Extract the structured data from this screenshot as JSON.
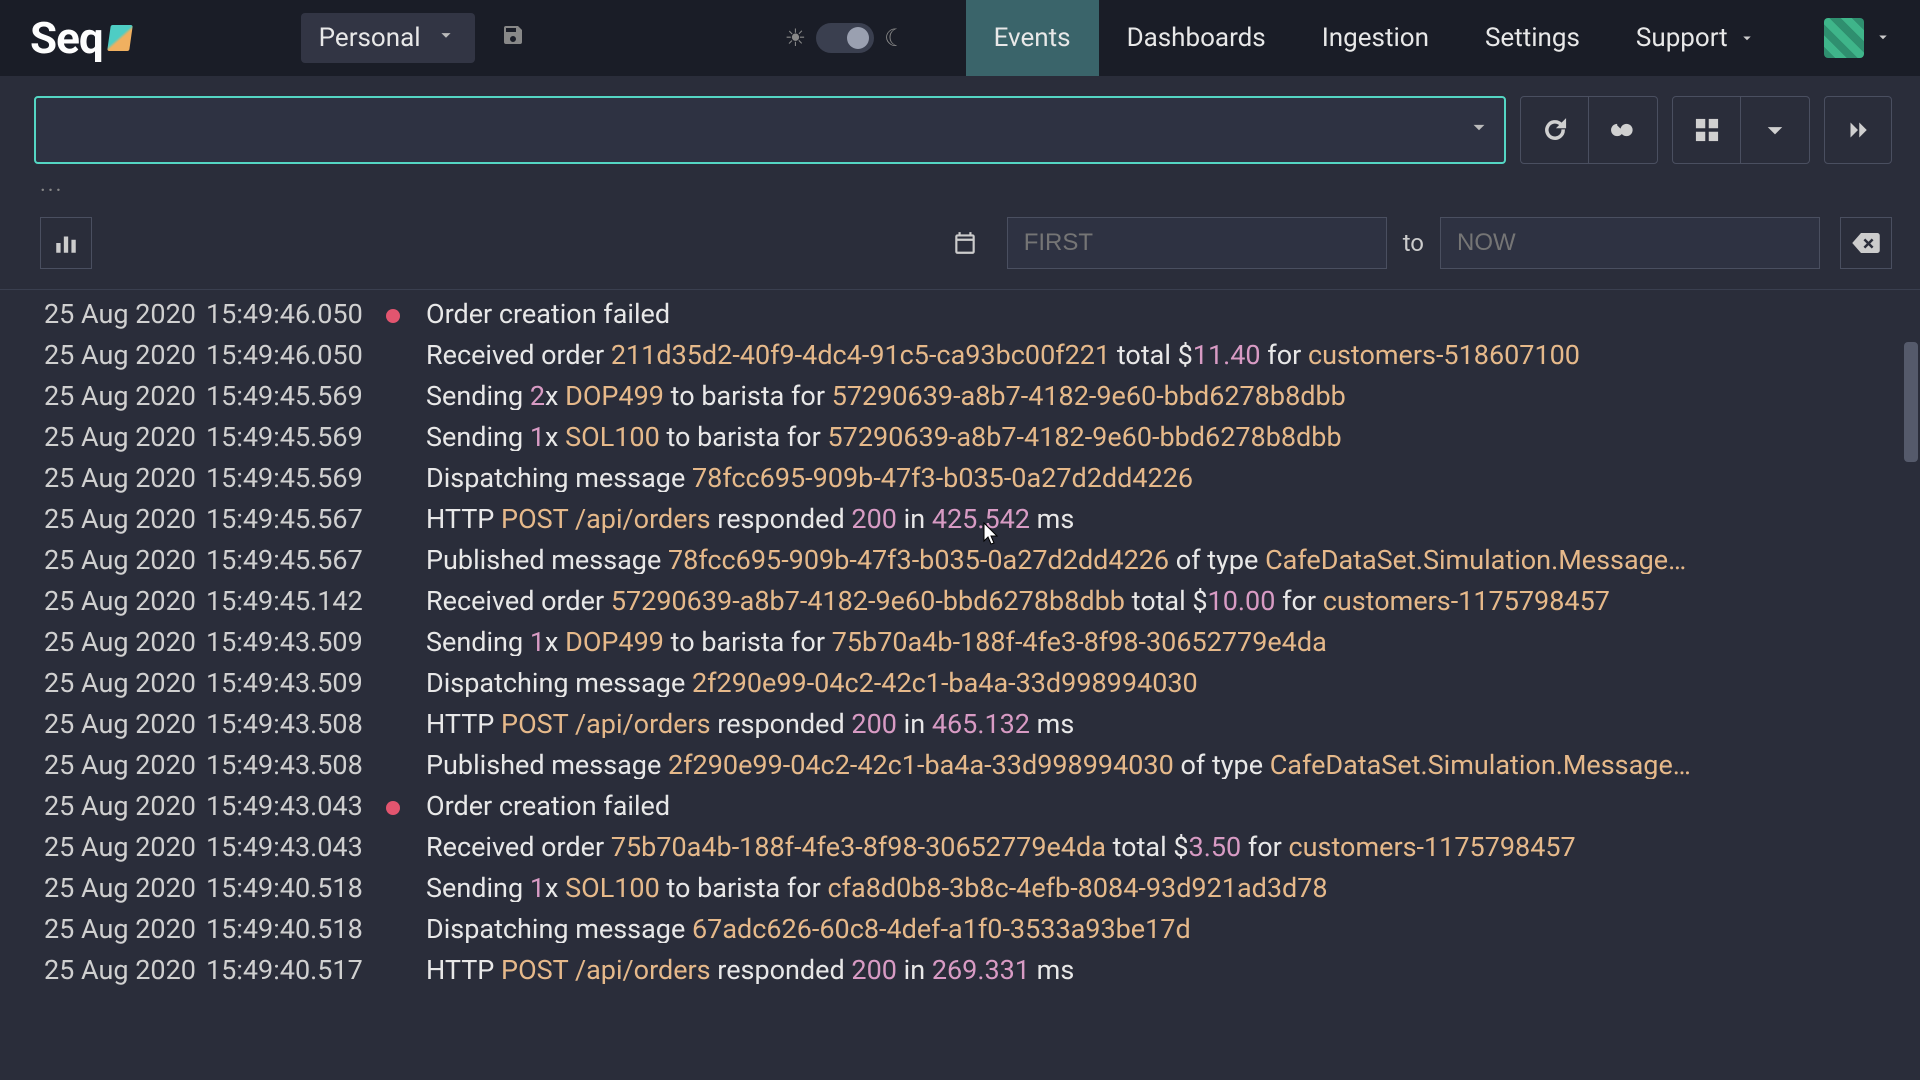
{
  "nav": {
    "logo_text": "Seq",
    "workspace": "Personal",
    "tabs": [
      "Events",
      "Dashboards",
      "Ingestion",
      "Settings",
      "Support"
    ],
    "active_tab": "Events"
  },
  "query": {
    "value": ""
  },
  "signals": {
    "placeholder": "..."
  },
  "range": {
    "from_placeholder": "FIRST",
    "to_label": "to",
    "to_placeholder": "NOW"
  },
  "colors": {
    "error": "#e2556f",
    "accent": "#54d6c3"
  },
  "events": [
    {
      "date": "25 Aug 2020",
      "time": "15:49:46.050",
      "level": "error",
      "parts": [
        {
          "t": "Order creation failed"
        }
      ]
    },
    {
      "date": "25 Aug 2020",
      "time": "15:49:46.050",
      "parts": [
        {
          "t": "Received order "
        },
        {
          "t": "211d35d2-40f9-4dc4-91c5-ca93bc00f221",
          "c": "tok-guid"
        },
        {
          "t": " total $"
        },
        {
          "t": "11.40",
          "c": "tok-num"
        },
        {
          "t": " for "
        },
        {
          "t": "customers-518607100",
          "c": "tok-cust"
        }
      ]
    },
    {
      "date": "25 Aug 2020",
      "time": "15:49:45.569",
      "parts": [
        {
          "t": "Sending "
        },
        {
          "t": "2",
          "c": "tok-num"
        },
        {
          "t": "x "
        },
        {
          "t": "DOP499",
          "c": "tok-code"
        },
        {
          "t": " to barista for "
        },
        {
          "t": "57290639-a8b7-4182-9e60-bbd6278b8dbb",
          "c": "tok-guid"
        }
      ]
    },
    {
      "date": "25 Aug 2020",
      "time": "15:49:45.569",
      "parts": [
        {
          "t": "Sending "
        },
        {
          "t": "1",
          "c": "tok-num"
        },
        {
          "t": "x "
        },
        {
          "t": "SOL100",
          "c": "tok-code"
        },
        {
          "t": " to barista for "
        },
        {
          "t": "57290639-a8b7-4182-9e60-bbd6278b8dbb",
          "c": "tok-guid"
        }
      ]
    },
    {
      "date": "25 Aug 2020",
      "time": "15:49:45.569",
      "parts": [
        {
          "t": "Dispatching message "
        },
        {
          "t": "78fcc695-909b-47f3-b035-0a27d2dd4226",
          "c": "tok-guid"
        }
      ]
    },
    {
      "date": "25 Aug 2020",
      "time": "15:49:45.567",
      "parts": [
        {
          "t": "HTTP "
        },
        {
          "t": "POST",
          "c": "tok-post"
        },
        {
          "t": " "
        },
        {
          "t": "/api/orders",
          "c": "tok-path"
        },
        {
          "t": " responded "
        },
        {
          "t": "200",
          "c": "tok-num"
        },
        {
          "t": " in "
        },
        {
          "t": "425.542",
          "c": "tok-num"
        },
        {
          "t": " ms"
        }
      ]
    },
    {
      "date": "25 Aug 2020",
      "time": "15:49:45.567",
      "parts": [
        {
          "t": "Published message "
        },
        {
          "t": "78fcc695-909b-47f3-b035-0a27d2dd4226",
          "c": "tok-guid"
        },
        {
          "t": " of type "
        },
        {
          "t": "CafeDataSet.Simulation.Message…",
          "c": "tok-type"
        }
      ]
    },
    {
      "date": "25 Aug 2020",
      "time": "15:49:45.142",
      "parts": [
        {
          "t": "Received order "
        },
        {
          "t": "57290639-a8b7-4182-9e60-bbd6278b8dbb",
          "c": "tok-guid"
        },
        {
          "t": " total $"
        },
        {
          "t": "10.00",
          "c": "tok-num"
        },
        {
          "t": " for "
        },
        {
          "t": "customers-1175798457",
          "c": "tok-cust"
        }
      ]
    },
    {
      "date": "25 Aug 2020",
      "time": "15:49:43.509",
      "parts": [
        {
          "t": "Sending "
        },
        {
          "t": "1",
          "c": "tok-num"
        },
        {
          "t": "x "
        },
        {
          "t": "DOP499",
          "c": "tok-code"
        },
        {
          "t": " to barista for "
        },
        {
          "t": "75b70a4b-188f-4fe3-8f98-30652779e4da",
          "c": "tok-guid"
        }
      ]
    },
    {
      "date": "25 Aug 2020",
      "time": "15:49:43.509",
      "parts": [
        {
          "t": "Dispatching message "
        },
        {
          "t": "2f290e99-04c2-42c1-ba4a-33d998994030",
          "c": "tok-guid"
        }
      ]
    },
    {
      "date": "25 Aug 2020",
      "time": "15:49:43.508",
      "parts": [
        {
          "t": "HTTP "
        },
        {
          "t": "POST",
          "c": "tok-post"
        },
        {
          "t": " "
        },
        {
          "t": "/api/orders",
          "c": "tok-path"
        },
        {
          "t": " responded "
        },
        {
          "t": "200",
          "c": "tok-num"
        },
        {
          "t": " in "
        },
        {
          "t": "465.132",
          "c": "tok-num"
        },
        {
          "t": " ms"
        }
      ]
    },
    {
      "date": "25 Aug 2020",
      "time": "15:49:43.508",
      "parts": [
        {
          "t": "Published message "
        },
        {
          "t": "2f290e99-04c2-42c1-ba4a-33d998994030",
          "c": "tok-guid"
        },
        {
          "t": " of type "
        },
        {
          "t": "CafeDataSet.Simulation.Message…",
          "c": "tok-type"
        }
      ]
    },
    {
      "date": "25 Aug 2020",
      "time": "15:49:43.043",
      "level": "error",
      "parts": [
        {
          "t": "Order creation failed"
        }
      ]
    },
    {
      "date": "25 Aug 2020",
      "time": "15:49:43.043",
      "parts": [
        {
          "t": "Received order "
        },
        {
          "t": "75b70a4b-188f-4fe3-8f98-30652779e4da",
          "c": "tok-guid"
        },
        {
          "t": " total $"
        },
        {
          "t": "3.50",
          "c": "tok-num"
        },
        {
          "t": " for "
        },
        {
          "t": "customers-1175798457",
          "c": "tok-cust"
        }
      ]
    },
    {
      "date": "25 Aug 2020",
      "time": "15:49:40.518",
      "parts": [
        {
          "t": "Sending "
        },
        {
          "t": "1",
          "c": "tok-num"
        },
        {
          "t": "x "
        },
        {
          "t": "SOL100",
          "c": "tok-code"
        },
        {
          "t": " to barista for "
        },
        {
          "t": "cfa8d0b8-3b8c-4efb-8084-93d921ad3d78",
          "c": "tok-guid"
        }
      ]
    },
    {
      "date": "25 Aug 2020",
      "time": "15:49:40.518",
      "parts": [
        {
          "t": "Dispatching message "
        },
        {
          "t": "67adc626-60c8-4def-a1f0-3533a93be17d",
          "c": "tok-guid"
        }
      ]
    },
    {
      "date": "25 Aug 2020",
      "time": "15:49:40.517",
      "parts": [
        {
          "t": "HTTP "
        },
        {
          "t": "POST",
          "c": "tok-post"
        },
        {
          "t": " "
        },
        {
          "t": "/api/orders",
          "c": "tok-path"
        },
        {
          "t": " responded "
        },
        {
          "t": "200",
          "c": "tok-num"
        },
        {
          "t": " in "
        },
        {
          "t": "269.331",
          "c": "tok-num"
        },
        {
          "t": " ms"
        }
      ]
    }
  ]
}
